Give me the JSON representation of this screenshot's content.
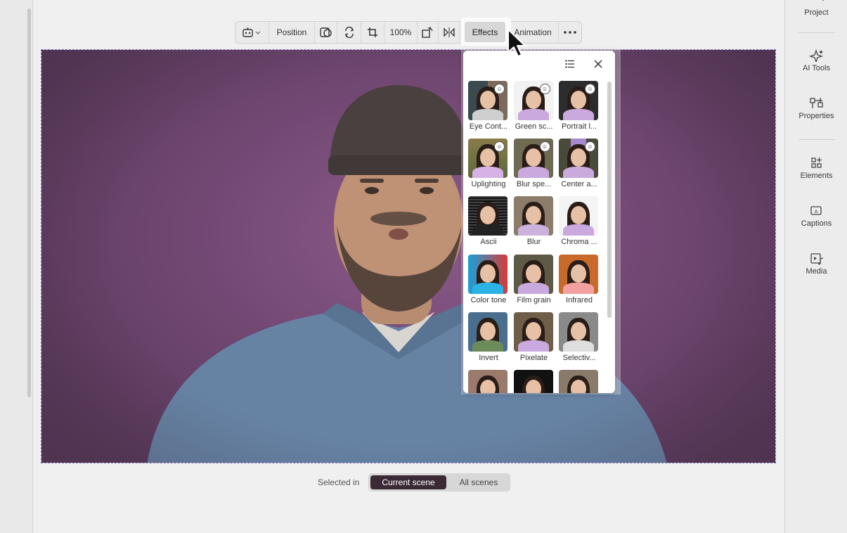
{
  "toolbar": {
    "position_label": "Position",
    "zoom_label": "100%",
    "effects_label": "Effects",
    "animation_label": "Animation"
  },
  "sidebar": {
    "items": [
      {
        "label": "Project",
        "icon": "folder-icon"
      },
      {
        "label": "AI Tools",
        "icon": "sparkle-icon"
      },
      {
        "label": "Properties",
        "icon": "sliders-icon"
      },
      {
        "label": "Elements",
        "icon": "shapes-icon"
      },
      {
        "label": "Captions",
        "icon": "captions-icon"
      },
      {
        "label": "Media",
        "icon": "media-icon"
      }
    ]
  },
  "effects_panel": {
    "items": [
      {
        "label": "Eye Cont...",
        "ai": true
      },
      {
        "label": "Green sc...",
        "ai": true
      },
      {
        "label": "Portrait l...",
        "ai": true
      },
      {
        "label": "Uplighting",
        "ai": true
      },
      {
        "label": "Blur spe...",
        "ai": true
      },
      {
        "label": "Center a...",
        "ai": true
      },
      {
        "label": "Ascii",
        "ai": false
      },
      {
        "label": "Blur",
        "ai": false
      },
      {
        "label": "Chroma ...",
        "ai": false
      },
      {
        "label": "Color tone",
        "ai": false
      },
      {
        "label": "Film grain",
        "ai": false
      },
      {
        "label": "Infrared",
        "ai": false
      },
      {
        "label": "Invert",
        "ai": false
      },
      {
        "label": "Pixelate",
        "ai": false
      },
      {
        "label": "Selectiv...",
        "ai": false
      },
      {
        "label": "",
        "ai": false
      },
      {
        "label": "",
        "ai": false
      },
      {
        "label": "",
        "ai": false
      }
    ]
  },
  "selected_in": {
    "label": "Selected in",
    "current_scene": "Current scene",
    "all_scenes": "All scenes"
  }
}
